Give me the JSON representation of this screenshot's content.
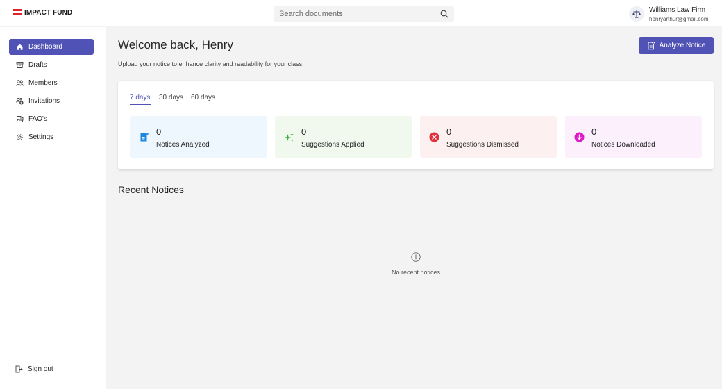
{
  "header": {
    "logo_text": "IMPACT FUND",
    "search": {
      "placeholder": "Search documents",
      "value": ""
    },
    "org": {
      "name": "Williams Law Firm",
      "email": "henryarthur@gmail.com",
      "avatar_icon": "scales-icon"
    }
  },
  "sidebar": {
    "items": [
      {
        "label": "Dashboard",
        "icon": "home-icon",
        "active": true
      },
      {
        "label": "Drafts",
        "icon": "archive-icon",
        "active": false
      },
      {
        "label": "Members",
        "icon": "people-icon",
        "active": false
      },
      {
        "label": "Invitations",
        "icon": "people-invite-icon",
        "active": false
      },
      {
        "label": "FAQ's",
        "icon": "chat-question-icon",
        "active": false
      },
      {
        "label": "Settings",
        "icon": "gear-icon",
        "active": false
      }
    ],
    "signout_label": "Sign out"
  },
  "main": {
    "welcome": "Welcome back, Henry",
    "subtitle": "Upload your notice to enhance clarity and readability for your class.",
    "analyze_button": "Analyze Notice",
    "tabs": [
      {
        "label": "7 days",
        "active": true
      },
      {
        "label": "30 days",
        "active": false
      },
      {
        "label": "60 days",
        "active": false
      }
    ],
    "stats": [
      {
        "value": "0",
        "label": "Notices Analyzed",
        "icon": "document-add-icon",
        "bg": "#eef6fe",
        "color": "#1a86e0"
      },
      {
        "value": "0",
        "label": "Suggestions Applied",
        "icon": "sparkle-icon",
        "bg": "#f1f9ef",
        "color": "#3bb33e"
      },
      {
        "value": "0",
        "label": "Suggestions Dismissed",
        "icon": "dismiss-circle-icon",
        "bg": "#fdf0f0",
        "color": "#e0313a"
      },
      {
        "value": "0",
        "label": "Notices Downloaded",
        "icon": "download-circle-icon",
        "bg": "#fdf0fd",
        "color": "#e019c8"
      }
    ],
    "recent_title": "Recent Notices",
    "empty_text": "No recent notices"
  },
  "colors": {
    "accent": "#5052b5",
    "logo_red": "#e0232b"
  }
}
